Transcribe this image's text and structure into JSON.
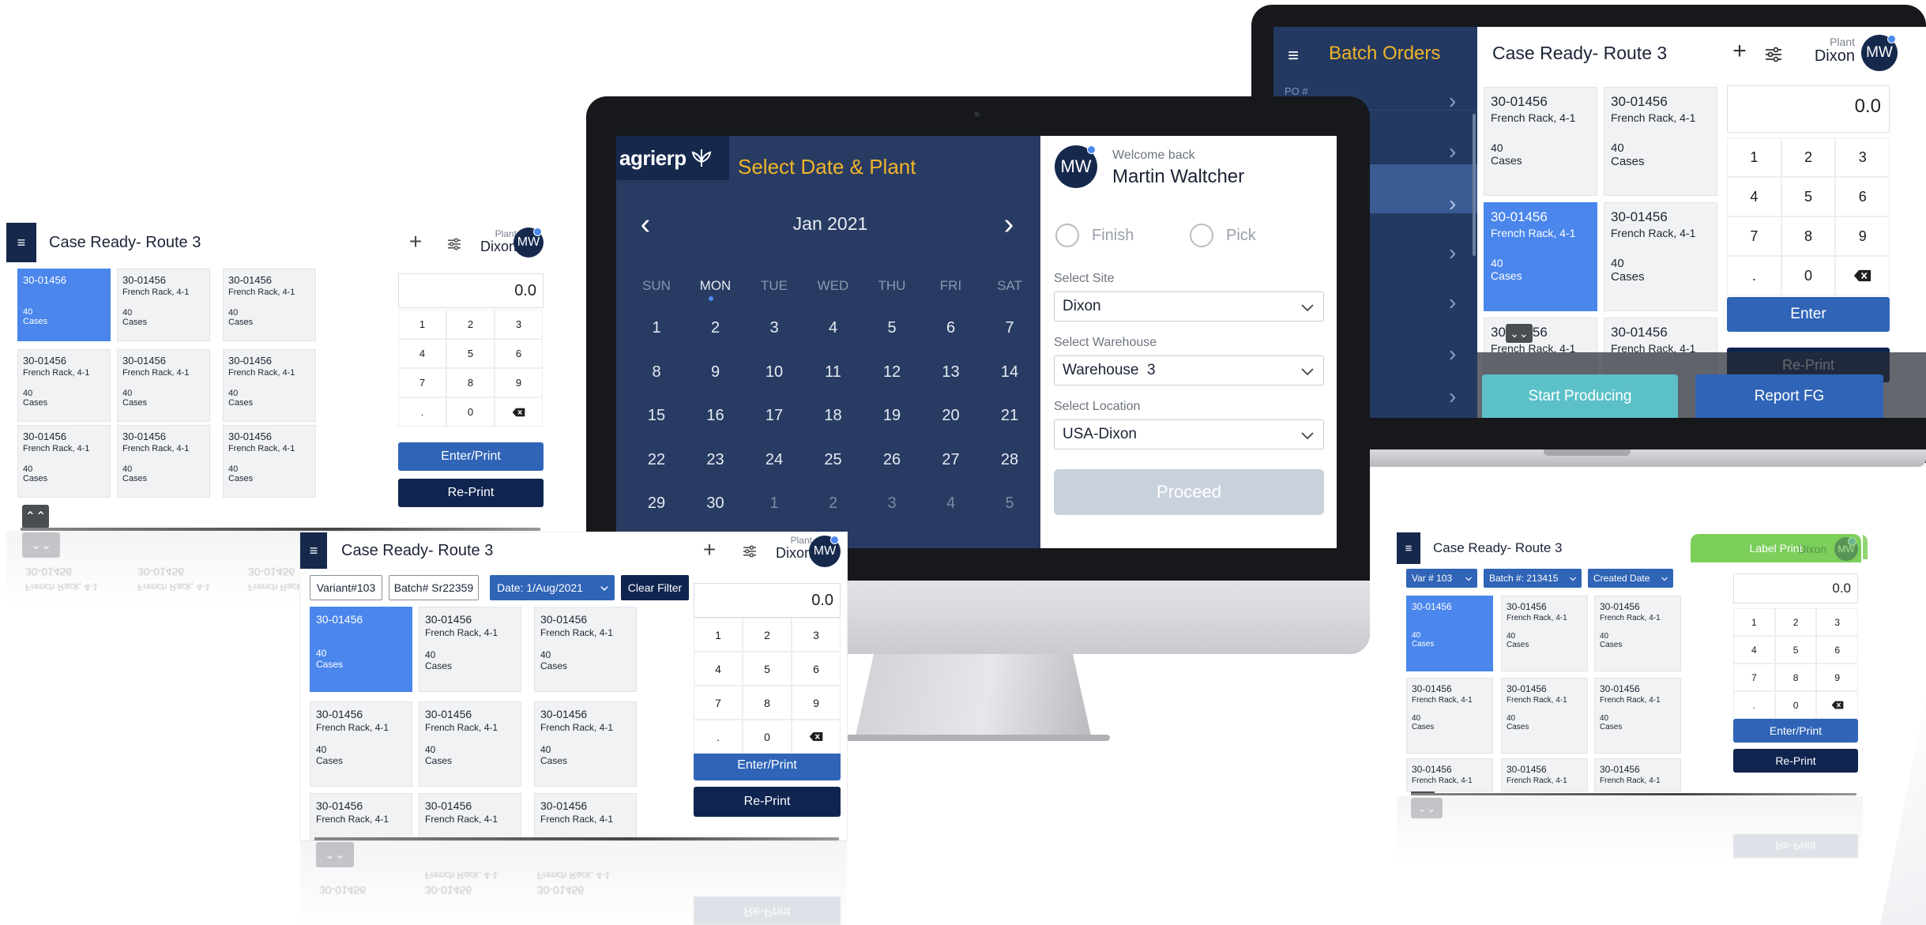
{
  "common": {
    "plant_label": "Plant",
    "plant_value": "Dixon",
    "avatar_initials": "MW",
    "enter_print": "Enter/Print",
    "reprint": "Re-Print",
    "enter": "Enter",
    "display_value": "0.0",
    "keys": [
      "1",
      "2",
      "3",
      "4",
      "5",
      "6",
      "7",
      "8",
      "9",
      ".",
      "0"
    ],
    "icons": {
      "menu": "hamburger-icon",
      "add": "plus-icon",
      "filter": "sliders-icon",
      "backspace": "backspace-icon",
      "scroll_up": "double-chevron-up-icon",
      "scroll_down": "double-chevron-down-icon"
    },
    "colors": {
      "navy": "#16294d",
      "selected_tile": "#4a86ec",
      "primary_button": "#2f64b7",
      "calendar_bg": "#283b62",
      "accent_gold": "#f0b429",
      "teal": "#5bc0c8",
      "green": "#7ccf5a"
    }
  },
  "tile": {
    "code": "30-01456",
    "desc": "French Rack, 4-1",
    "qty": "40",
    "unit": "Cases"
  },
  "left_tablet": {
    "title": "Case Ready- Route 3"
  },
  "bottom_tablet": {
    "title": "Case Ready- Route 3",
    "filters": {
      "variant": "Variant#103",
      "batch": "Batch# Sr22359",
      "date": "Date: 1/Aug/2021",
      "clear": "Clear Filter"
    }
  },
  "right_tablet": {
    "title": "Case Ready- Route 3",
    "filters": {
      "variant": "Var # 103",
      "batch": "Batch #: 213415",
      "created": "Created Date"
    },
    "label_print": "Label  Print"
  },
  "laptop": {
    "sidebar_title": "Batch Orders",
    "sidebar_first_item": "PO #",
    "title": "Case Ready- Route 3",
    "start_producing": "Start Producing",
    "report_fg": "Report FG"
  },
  "monitor": {
    "logo_text": "agrierp",
    "title": "Select Date & Plant",
    "month": "Jan 2021",
    "weekdays": [
      "SUN",
      "MON",
      "TUE",
      "WED",
      "THU",
      "FRI",
      "SAT"
    ],
    "weeks": [
      [
        "1",
        "2",
        "3",
        "4",
        "5",
        "6",
        "7"
      ],
      [
        "8",
        "9",
        "10",
        "11",
        "12",
        "13",
        "14"
      ],
      [
        "15",
        "16",
        "17",
        "18",
        "19",
        "20",
        "21"
      ],
      [
        "22",
        "23",
        "24",
        "25",
        "26",
        "27",
        "28"
      ],
      [
        "29",
        "30",
        "1",
        "2",
        "3",
        "4",
        "5"
      ]
    ],
    "welcome": "Welcome back",
    "user_name": "Martin Waltcher",
    "radio_finish": "Finish",
    "radio_pick": "Pick",
    "site_label": "Select Site",
    "site_value": "Dixon",
    "warehouse_label": "Select Warehouse",
    "warehouse_value": "Warehouse  3",
    "location_label": "Select Location",
    "location_value": "USA-Dixon",
    "proceed": "Proceed"
  }
}
